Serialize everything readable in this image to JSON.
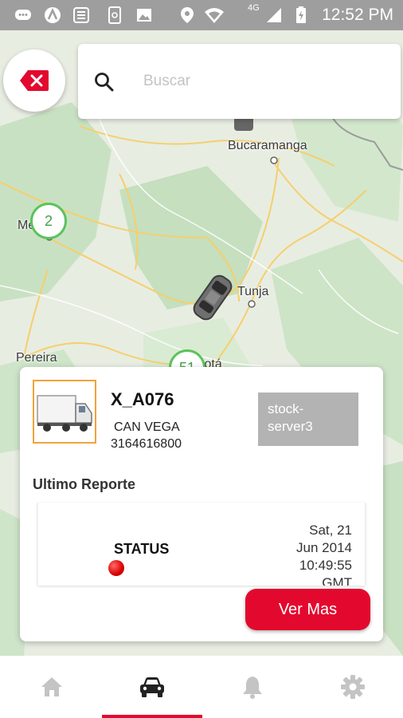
{
  "status_bar": {
    "time": "12:52 PM",
    "network": "4G",
    "icons": [
      "chat-icon",
      "app-icon",
      "news-icon",
      "phone-app-icon",
      "image-icon",
      "location-icon",
      "wifi-icon",
      "signal-icon",
      "battery-charging-icon"
    ]
  },
  "search": {
    "placeholder": "Buscar",
    "value": ""
  },
  "close_button": {
    "icon": "close-icon",
    "color": "#e3092e"
  },
  "map": {
    "cities": [
      "Bucaramanga",
      "Medellín",
      "Tunja",
      "Pereira",
      "Bogotá"
    ],
    "clusters": [
      "2",
      "51"
    ]
  },
  "vehicle_card": {
    "name": "X_A076",
    "driver": "CAN VEGA",
    "phone": "3164616800",
    "server": "stock-server3",
    "section_title": "Ultimo Reporte",
    "report": {
      "status": "STATUS",
      "status_color": "#d90000",
      "date_lines": [
        "Sat, 21",
        "Jun 2014",
        "10:49:55",
        "GMT"
      ]
    },
    "action_label": "Ver Mas"
  },
  "bottom_nav": {
    "items": [
      {
        "icon": "home-icon",
        "active": false
      },
      {
        "icon": "car-icon",
        "active": true
      },
      {
        "icon": "bell-icon",
        "active": false
      },
      {
        "icon": "gear-icon",
        "active": false
      }
    ],
    "accent": "#e3092e"
  }
}
